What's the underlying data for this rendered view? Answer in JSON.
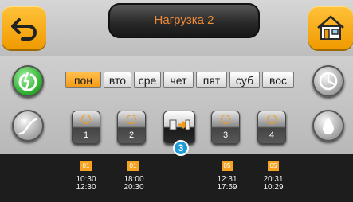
{
  "header": {
    "title": "Нагрузка 2"
  },
  "days": [
    {
      "label": "пон",
      "active": true
    },
    {
      "label": "вто",
      "active": false
    },
    {
      "label": "сре",
      "active": false
    },
    {
      "label": "чет",
      "active": false
    },
    {
      "label": "пят",
      "active": false
    },
    {
      "label": "суб",
      "active": false
    },
    {
      "label": "вос",
      "active": false
    }
  ],
  "slots": [
    {
      "label": "1"
    },
    {
      "label": "2"
    },
    {
      "label": "3"
    },
    {
      "label": "4"
    }
  ],
  "add_badge": "3",
  "schedule": [
    {
      "mode": "01",
      "start": "10:30",
      "end": "12:30"
    },
    {
      "mode": "01",
      "start": "18:00",
      "end": "20:30"
    },
    {
      "mode": "05",
      "start": "12:31",
      "end": "17:59"
    },
    {
      "mode": "05",
      "start": "20:31",
      "end": "10:29"
    }
  ],
  "colors": {
    "accent": "#f39a14",
    "title_text": "#f08a36",
    "badge": "#1e9ad6"
  },
  "icons": {
    "back": "back-arrow-icon",
    "home": "home-icon",
    "power": "power-icon",
    "weather": "weather-curve-icon",
    "clock": "clock-chart-icon",
    "drop": "water-drop-icon"
  }
}
